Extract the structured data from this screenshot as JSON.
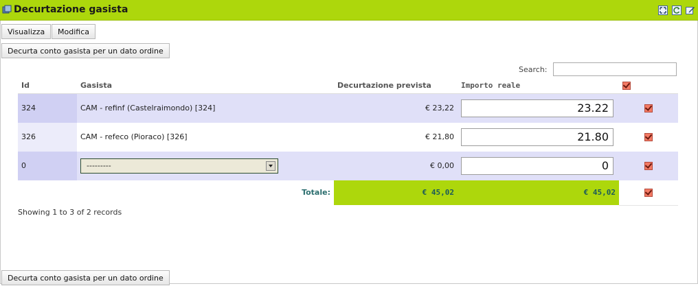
{
  "window": {
    "title": "Decurtazione gasista",
    "colors": {
      "titlebar": "#add70c",
      "total_highlight": "#add70c",
      "importo_header": "#1a2bd6"
    },
    "icons": [
      "window-title-icon",
      "maximize-icon",
      "refresh-icon",
      "edit-icon"
    ]
  },
  "toolbar": {
    "visualizza_label": "Visualizza",
    "modifica_label": "Modifica"
  },
  "actions": {
    "decurta_label": "Decurta conto gasista per un dato ordine"
  },
  "search": {
    "label": "Search:",
    "value": ""
  },
  "table": {
    "headers": {
      "id": "Id",
      "gasista": "Gasista",
      "decurtazione": "Decurtazione prevista",
      "importo": "Importo reale"
    },
    "rows": [
      {
        "id": "324",
        "gasista": "CAM - refinf (Castelraimondo) [324]",
        "decurtazione": "€ 23,22",
        "importo": "23.22",
        "checked": true
      },
      {
        "id": "326",
        "gasista": "CAM - refeco (Pioraco) [326]",
        "decurtazione": "€ 21,80",
        "importo": "21.80",
        "checked": true
      },
      {
        "id": "0",
        "gasista": "---------",
        "decurtazione": "€ 0,00",
        "importo": "0",
        "checked": true
      }
    ],
    "totals": {
      "label": "Totale:",
      "decurtazione": "€ 45,02",
      "importo": "€ 45,02"
    }
  },
  "footer": {
    "showing": "Showing 1 to 3 of 2 records"
  }
}
